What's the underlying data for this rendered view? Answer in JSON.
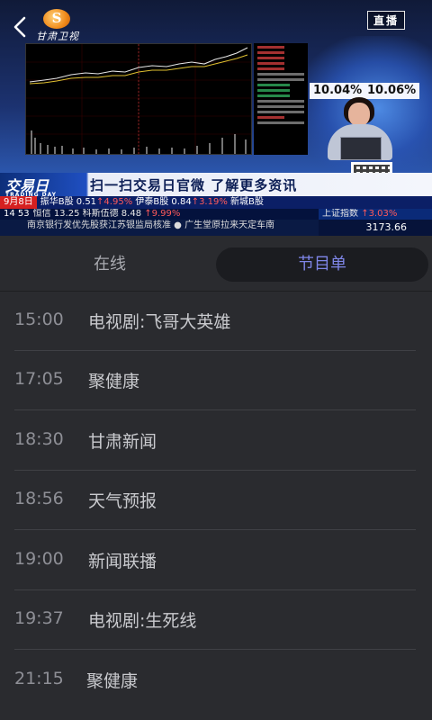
{
  "player": {
    "channel_logo_text": "甘肃卫视",
    "live_badge": "直播",
    "overlay": {
      "pct_left": "10.04%",
      "pct_right": "10.06%",
      "banner_brand": "交易日",
      "banner_brand_en": "TRADING DAY",
      "banner_message": "扫一扫交易日官微  了解更多资讯"
    },
    "ticker_row1": {
      "date": "9月8日",
      "text": "振华B股 0.51",
      "up1": "↑4.95%",
      "text2": " 伊泰B股 0.84",
      "up2": "↑3.19%",
      "text3": " 新城B股"
    },
    "ticker_row2": {
      "time": "14 53",
      "text": "恒信 13.25",
      "text2": " 科斯伍德 8.48",
      "up": "↑9.99%",
      "index_label": "上证指数",
      "index_change": "↑3.03%"
    },
    "ticker_row3": {
      "news": "南京银行发优先股获江苏银监局核准  ● 广生堂原拉来天定车南",
      "index_value": "3173.66"
    }
  },
  "tabs": {
    "online": "在线",
    "schedule": "节目单"
  },
  "schedule": [
    {
      "time": "15:00",
      "title": "电视剧:飞哥大英雄"
    },
    {
      "time": "17:05",
      "title": "聚健康"
    },
    {
      "time": "18:30",
      "title": "甘肃新闻"
    },
    {
      "time": "18:56",
      "title": "天气预报"
    },
    {
      "time": "19:00",
      "title": "新闻联播"
    },
    {
      "time": "19:37",
      "title": "电视剧:生死线"
    },
    {
      "time": "21:15",
      "title": "聚健康"
    }
  ],
  "colors": {
    "background": "#2a2b2f",
    "active_tab_text": "#7f86e8",
    "active_tab_bg": "#1b1c20",
    "time_text": "#8e8f96",
    "title_text": "#c9cace"
  },
  "icons": {
    "back": "chevron-left-icon",
    "logo": "channel-logo-icon",
    "qr": "qr-code-icon"
  }
}
